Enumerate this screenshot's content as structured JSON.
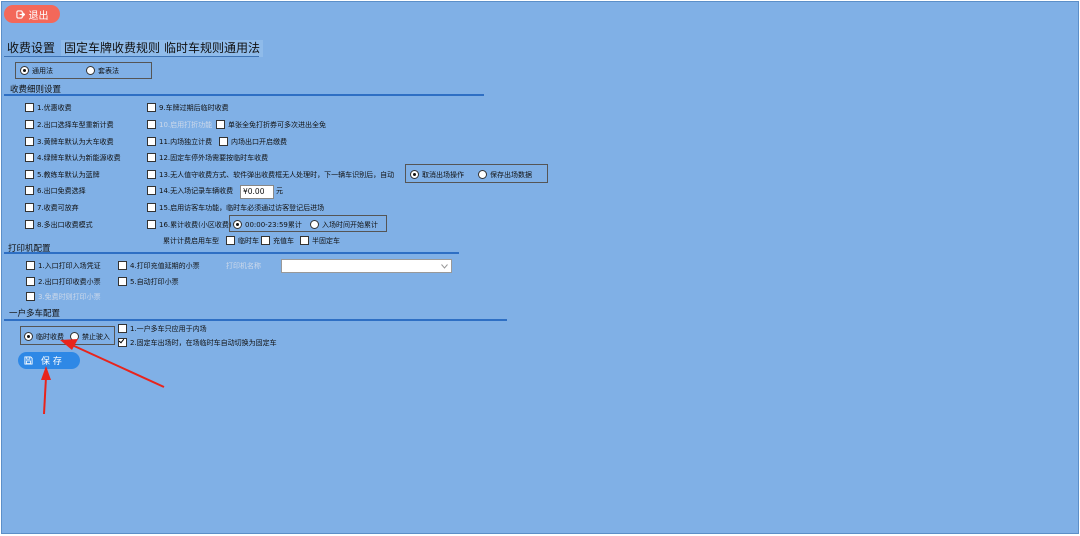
{
  "header": {
    "exit_label": "退出"
  },
  "tabs": [
    {
      "label": "收费设置"
    },
    {
      "label": "固定车牌收费规则"
    },
    {
      "label": "临时车规则通用法"
    }
  ],
  "mode": {
    "options": [
      "通用法",
      "套表法"
    ],
    "selected": 0
  },
  "fee_details": {
    "title": "收费细则设置",
    "left_items": [
      "1.优惠收费",
      "2.出口选择车型重新计费",
      "3.黄牌车默认为大车收费",
      "4.绿牌车默认为新能源收费",
      "5.教练车默认为蓝牌",
      "6.出口免费选择",
      "7.收费可放弃",
      "8.多出口收费模式"
    ],
    "item9": "9.车牌过期后临时收费",
    "item10": "10.启用打折功能",
    "item10b": "单张全免打折券可多次进出全免",
    "item11": "11.内场独立计费",
    "item11b": "内场出口开启缴费",
    "item12": "12.固定车停外场需要按临时车收费",
    "item13": "13.无人值守收费方式、软件弹出收费框无人处理时，下一辆车识别后，自动",
    "item13_options": [
      "取消出场操作",
      "保存出场数据"
    ],
    "item13_selected": 0,
    "item14": "14.无入场记录车辆收费",
    "item14_amount": "¥0.00",
    "item14_unit": "元",
    "item15": "15.启用访客车功能，临时车必须通过访客登记后进场",
    "item16": "16.累计收费(小区收费)",
    "item16_options": [
      "00:00-23:59累计",
      "入场时间开始累计"
    ],
    "item16_selected": 0,
    "cumulative_label": "累计计费启用车型",
    "cumulative_types": [
      "临时车",
      "充值车",
      "半固定车"
    ]
  },
  "printer": {
    "title": "打印机配置",
    "items": [
      "1.入口打印入场凭证",
      "2.出口打印收费小票",
      "3.免费时则打印小票",
      "4.打印充值延期的小票",
      "5.自动打印小票"
    ],
    "printer_name_label": "打印机名称"
  },
  "multi_car": {
    "title": "一户多车配置",
    "options": [
      "临时收费",
      "禁止驶入"
    ],
    "selected": 0,
    "items": [
      "1.一户多车只应用于内场",
      "2.固定车出场时，在场临时车自动切换为固定车"
    ],
    "checked": [
      false,
      true
    ]
  },
  "save": {
    "label": "保 存"
  },
  "colors": {
    "background": "#80b0e6",
    "exit_button": "#f3685a",
    "save_button": "#2e88e6",
    "section_line": "#2e6fc4",
    "annotation_arrow": "#e8241c"
  }
}
